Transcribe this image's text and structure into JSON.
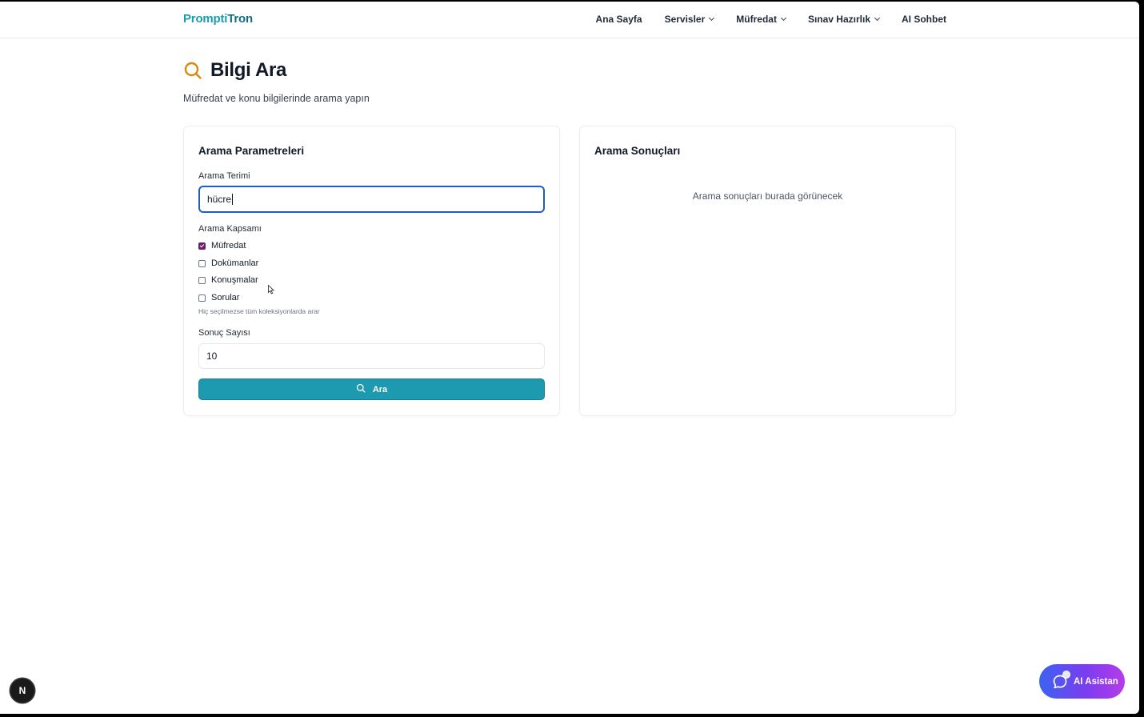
{
  "navbar": {
    "logo_part1": "Prompti",
    "logo_part2": "Tron",
    "links": [
      {
        "label": "Ana Sayfa",
        "has_dropdown": false
      },
      {
        "label": "Servisler",
        "has_dropdown": true
      },
      {
        "label": "Müfredat",
        "has_dropdown": true
      },
      {
        "label": "Sınav Hazırlık",
        "has_dropdown": true
      },
      {
        "label": "AI Sohbet",
        "has_dropdown": false
      }
    ]
  },
  "header": {
    "title": "Bilgi Ara",
    "subtitle": "Müfredat ve konu bilgilerinde arama yapın",
    "icon": "search-icon",
    "icon_color": "#d68a0b"
  },
  "params": {
    "title": "Arama Parametreleri",
    "term_label": "Arama Terimi",
    "term_value": "hücre",
    "scope_label": "Arama Kapsamı",
    "scopes": [
      {
        "label": "Müfredat",
        "checked": true
      },
      {
        "label": "Dokümanlar",
        "checked": false
      },
      {
        "label": "Konuşmalar",
        "checked": false
      },
      {
        "label": "Sorular",
        "checked": false
      }
    ],
    "scope_hint": "Hiç seçilmezse tüm koleksiyonlarda arar",
    "count_label": "Sonuç Sayısı",
    "count_value": "10",
    "button_label": "Ara",
    "button_color": "#1e9ab0"
  },
  "results": {
    "title": "Arama Sonuçları",
    "empty_text": "Arama sonuçları burada görünecek"
  },
  "floating": {
    "next_badge": "N",
    "ai_button_label": "AI Asistan"
  }
}
